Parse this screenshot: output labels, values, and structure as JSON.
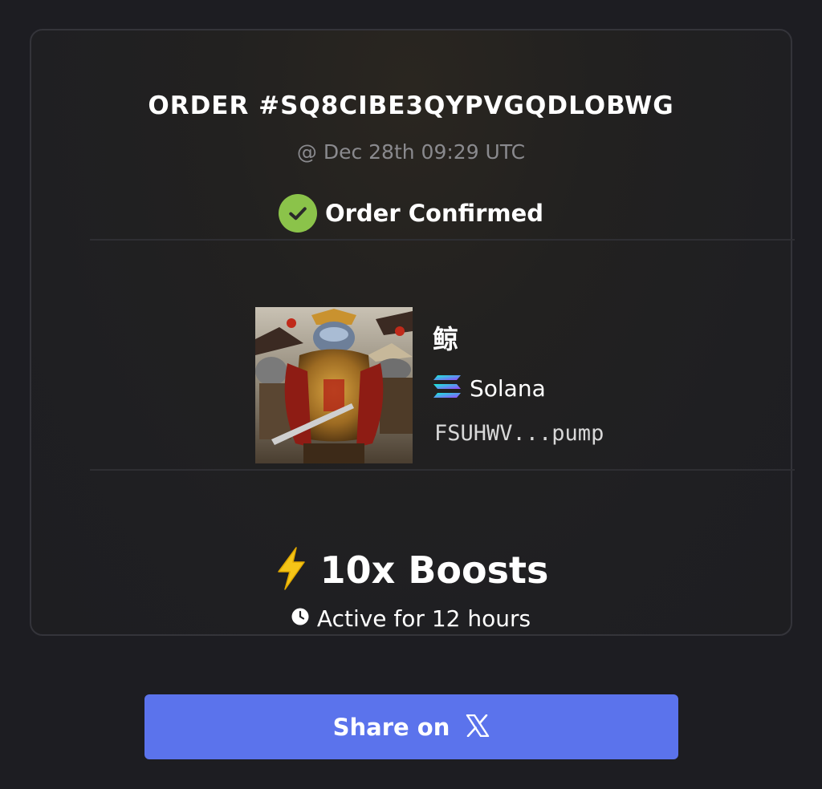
{
  "order": {
    "id_text": "ORDER #SQ8CIBE3QYPVGQDLOBWG",
    "timestamp": "@ Dec 28th 09:29 UTC",
    "status": "Order Confirmed",
    "status_color": "#8bc34a"
  },
  "token": {
    "name": "鲸",
    "chain": "Solana",
    "address": "FSUHWV...pump",
    "image_icon": "whale-warrior-image"
  },
  "boost": {
    "icon": "lightning-icon",
    "label": "10x Boosts",
    "duration_icon": "clock-icon",
    "duration": "Active for 12 hours"
  },
  "share": {
    "label": "Share on",
    "icon": "x-logo-icon",
    "color": "#5b73ec"
  }
}
